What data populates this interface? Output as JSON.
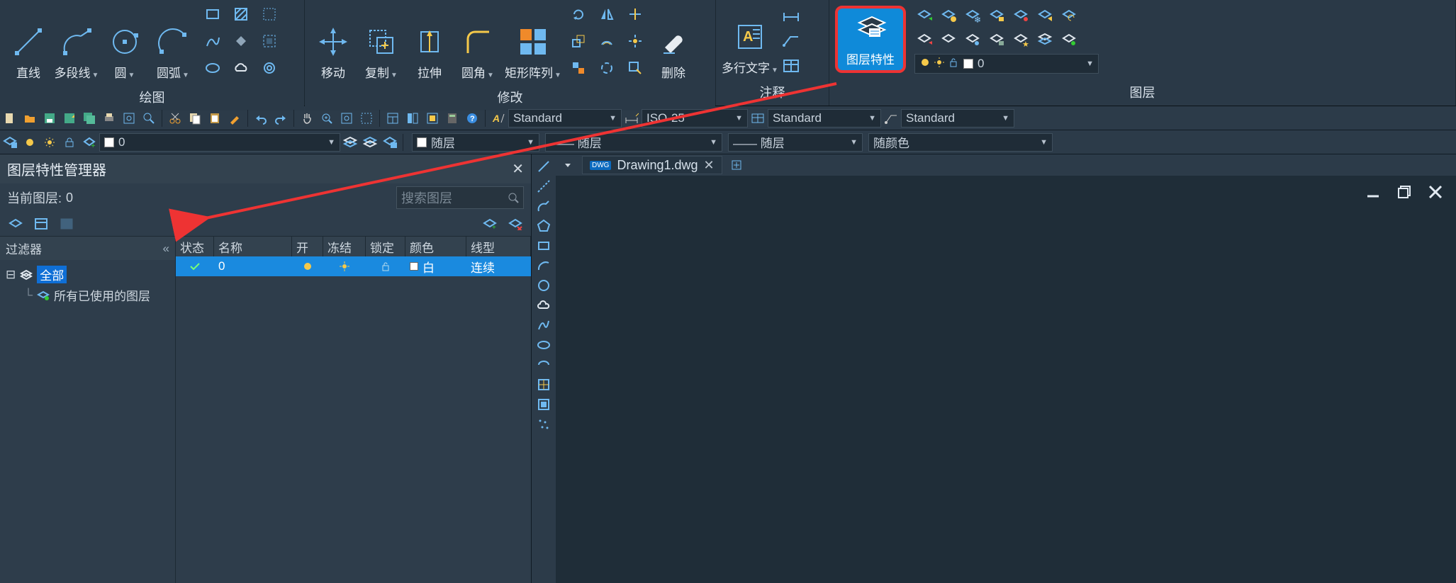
{
  "ribbon": {
    "panels": {
      "draw": {
        "title": "绘图",
        "line": "直线",
        "polyline": "多段线",
        "circle": "圆",
        "arc": "圆弧"
      },
      "modify": {
        "title": "修改",
        "move": "移动",
        "copy": "复制",
        "stretch": "拉伸",
        "fillet": "圆角",
        "array": "矩形阵列",
        "delete": "删除"
      },
      "annot": {
        "title": "注释",
        "mtext": "多行文字"
      },
      "layer": {
        "title": "图层",
        "props": "图层特性",
        "current": "0"
      }
    }
  },
  "qbar": {
    "style1": "Standard",
    "dimstyle": "ISO-25",
    "style2": "Standard",
    "style3": "Standard"
  },
  "props": {
    "layer_current": "0",
    "bylayer1": "随层",
    "bylayer2": "—— 随层",
    "bylayer3": "—— 随层",
    "bycolor": "随颜色"
  },
  "layerpanel": {
    "title": "图层特性管理器",
    "current_label": "当前图层:",
    "current_value": "0",
    "search_placeholder": "搜索图层",
    "filter_hdr": "过滤器",
    "tree_all": "全部",
    "tree_used": "所有已使用的图层",
    "columns": {
      "status": "状态",
      "name": "名称",
      "on": "开",
      "freeze": "冻结",
      "lock": "锁定",
      "color": "颜色",
      "linetype": "线型"
    },
    "row": {
      "name": "0",
      "color": "白",
      "linetype": "连续"
    }
  },
  "tab": {
    "filename": "Drawing1.dwg"
  }
}
